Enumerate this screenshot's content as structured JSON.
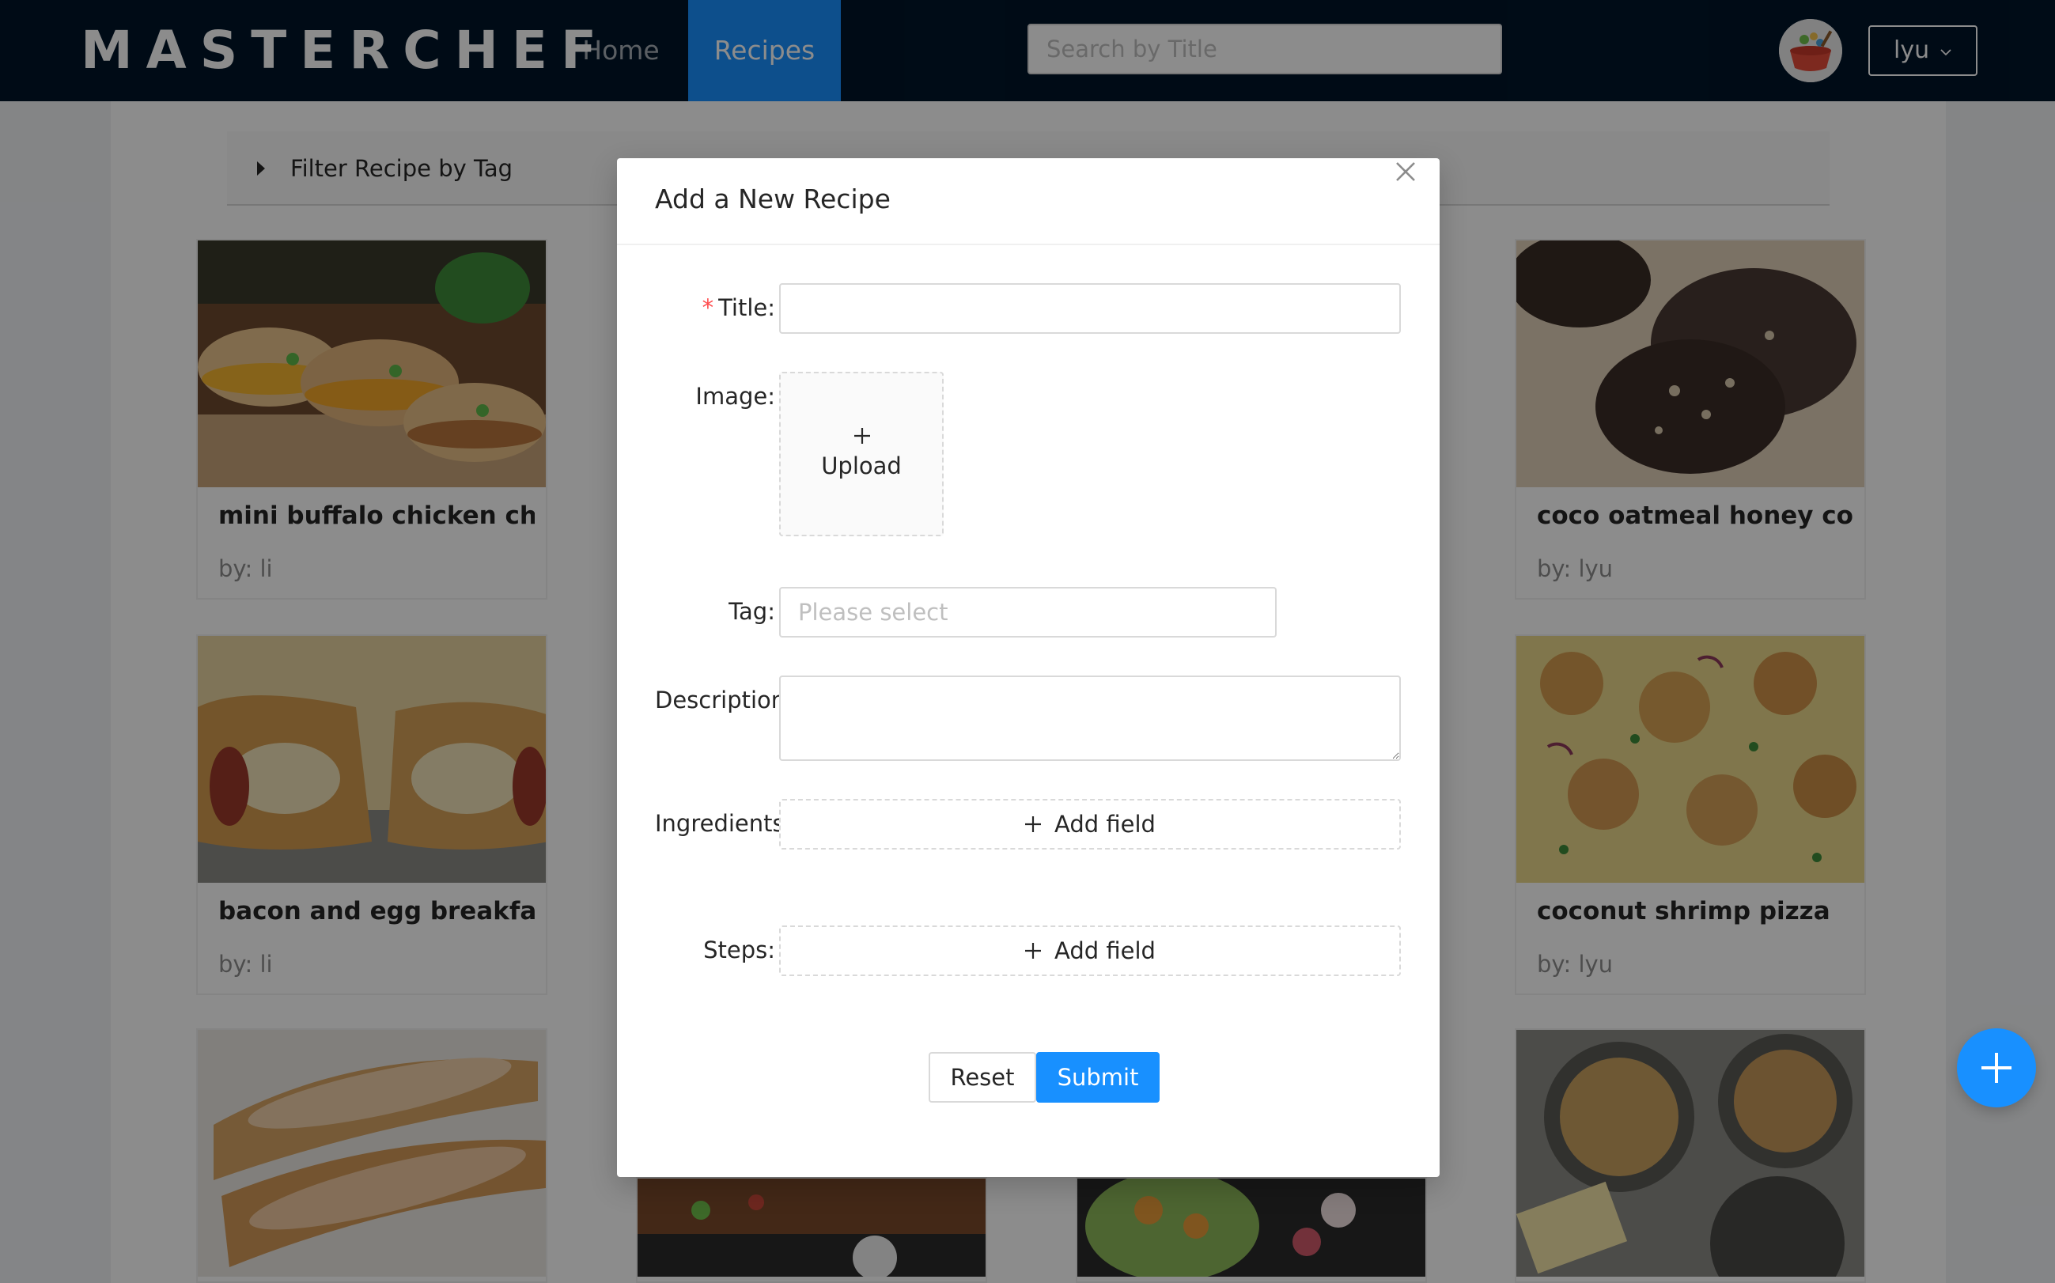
{
  "header": {
    "logo": "MASTERCHEF",
    "nav": [
      "Home",
      "Recipes"
    ],
    "active_nav": "Recipes",
    "search_placeholder": "Search by Title",
    "user": "lyu"
  },
  "filter": {
    "label": "Filter Recipe by Tag"
  },
  "cards": [
    {
      "title": "mini buffalo chicken chee...",
      "author": "by: li"
    },
    {
      "title": "coco oatmeal honey cook...",
      "author": "by: lyu"
    },
    {
      "title": "bacon and egg breakfast ...",
      "author": "by: li"
    },
    {
      "title": "coconut shrimp pizza",
      "author": "by: lyu"
    }
  ],
  "modal": {
    "title": "Add a New Recipe",
    "fields": {
      "title_label": "Title",
      "image_label": "Image",
      "upload_text": "Upload",
      "tag_label": "Tag",
      "tag_placeholder": "Please select",
      "description_label": "Description",
      "ingredients_label": "Ingredients",
      "steps_label": "Steps",
      "add_field_text": "Add field"
    },
    "buttons": {
      "reset": "Reset",
      "submit": "Submit"
    }
  },
  "colors": {
    "header_bg": "#001529",
    "accent": "#1890ff",
    "required": "#ff4d4f"
  }
}
